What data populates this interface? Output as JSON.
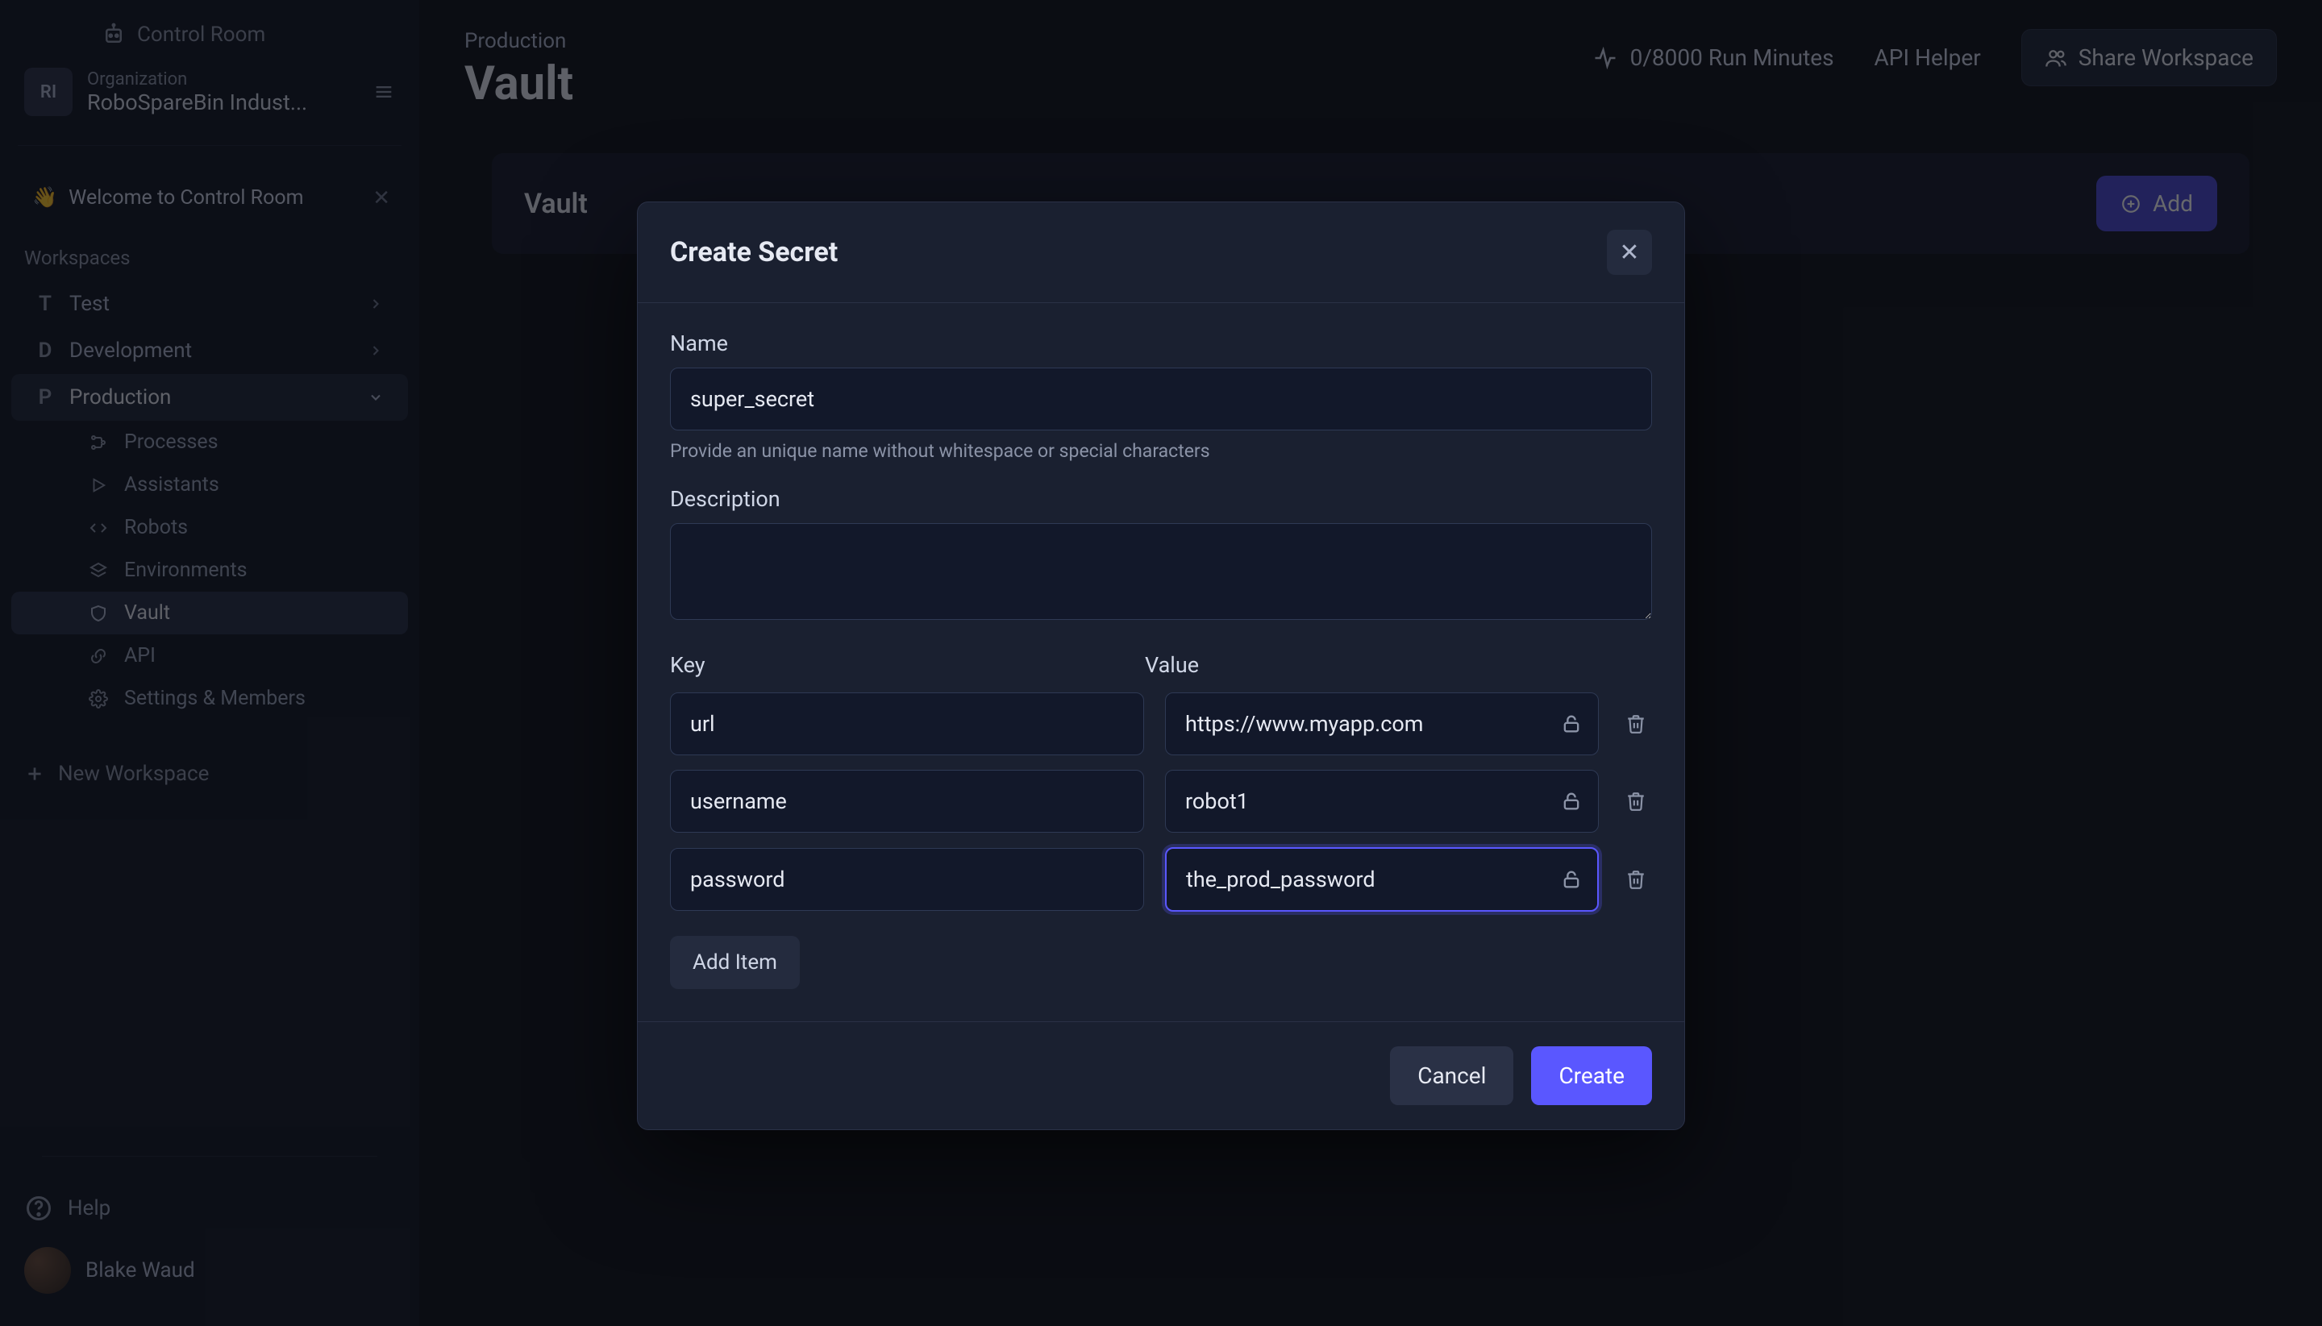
{
  "brand": {
    "name": "Control Room"
  },
  "org": {
    "label": "Organization",
    "name": "RoboSpareBin Indust...",
    "initials": "RI"
  },
  "welcome": {
    "text": "Welcome to Control Room"
  },
  "sidebar": {
    "section": "Workspaces",
    "workspaces": [
      {
        "letter": "T",
        "name": "Test"
      },
      {
        "letter": "D",
        "name": "Development"
      },
      {
        "letter": "P",
        "name": "Production"
      }
    ],
    "sub": {
      "processes": "Processes",
      "assistants": "Assistants",
      "robots": "Robots",
      "environments": "Environments",
      "vault": "Vault",
      "api": "API",
      "settings": "Settings & Members"
    },
    "new_workspace": "New Workspace",
    "help": "Help",
    "user": "Blake Waud"
  },
  "topbar": {
    "crumb": "Production",
    "title": "Vault",
    "run_minutes": "0/8000 Run Minutes",
    "api_helper": "API Helper",
    "share": "Share Workspace"
  },
  "vault": {
    "heading": "Vault",
    "add": "Add"
  },
  "modal": {
    "title": "Create Secret",
    "name_label": "Name",
    "name_value": "super_secret",
    "name_help": "Provide an unique name without whitespace or special characters",
    "desc_label": "Description",
    "desc_value": "",
    "key_label": "Key",
    "value_label": "Value",
    "rows": [
      {
        "key": "url",
        "value": "https://www.myapp.com"
      },
      {
        "key": "username",
        "value": "robot1"
      },
      {
        "key": "password",
        "value": "the_prod_password"
      }
    ],
    "add_item": "Add Item",
    "cancel": "Cancel",
    "create": "Create"
  }
}
